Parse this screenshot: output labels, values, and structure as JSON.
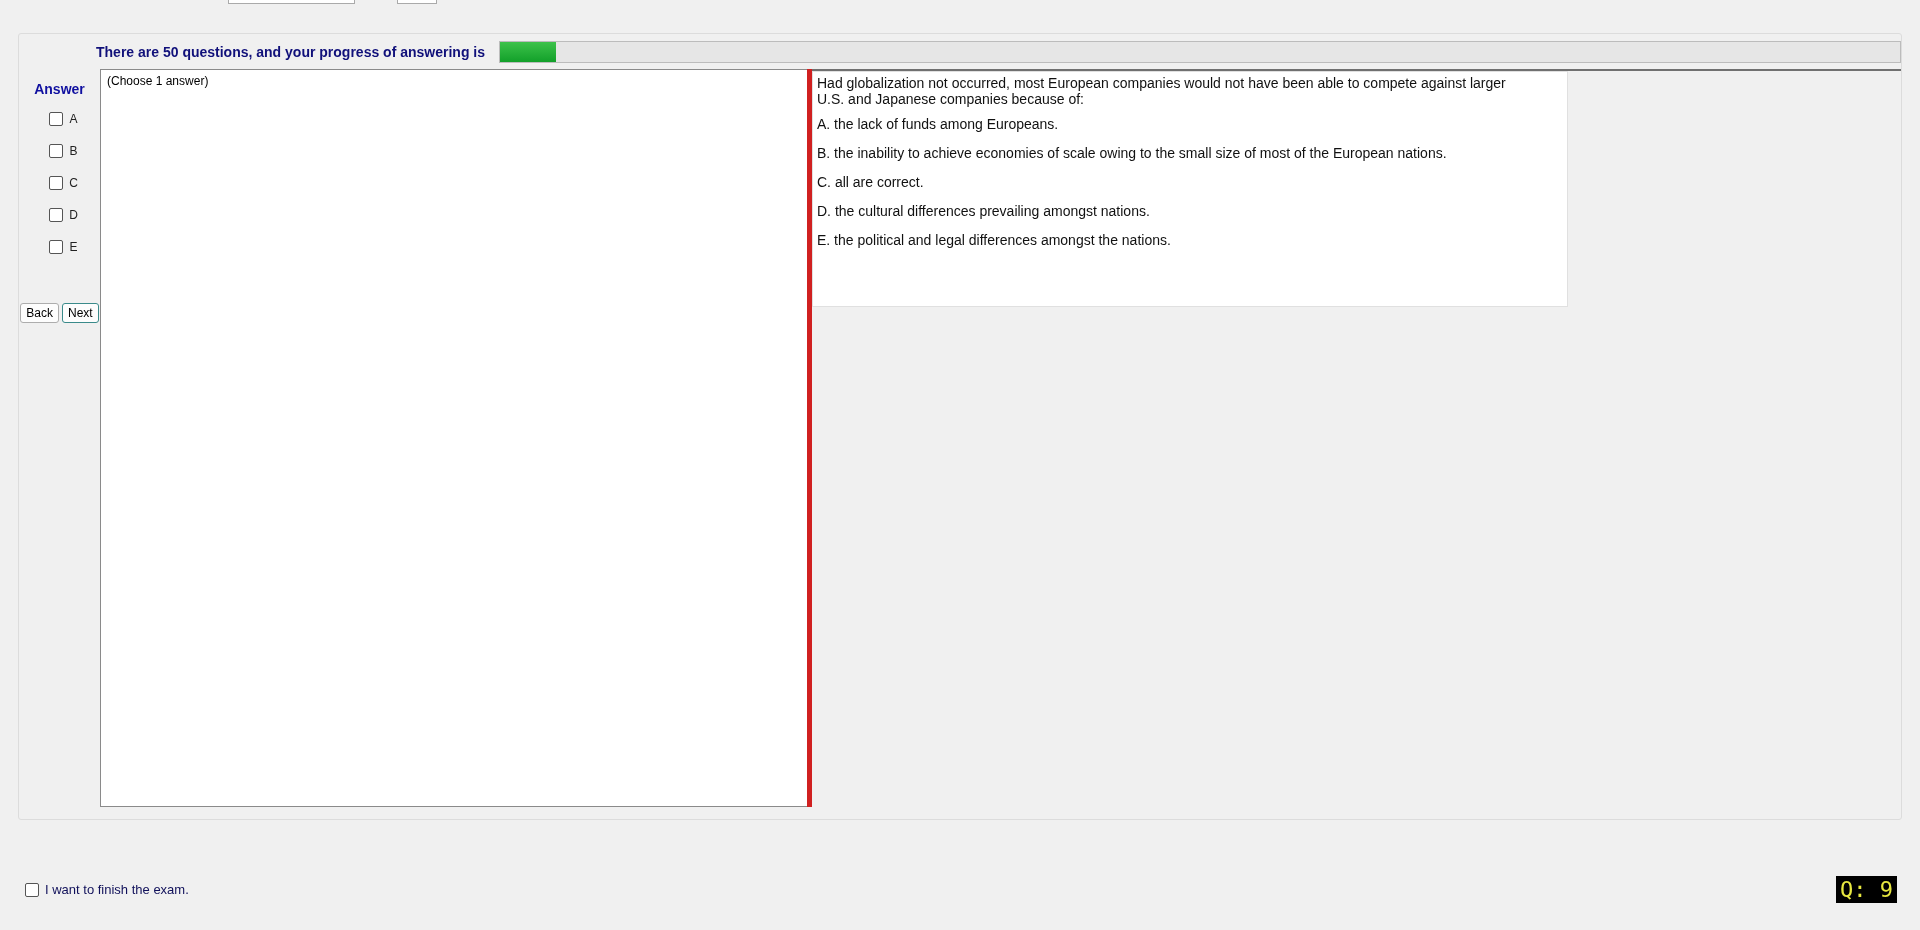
{
  "progress": {
    "label": "There are 50 questions, and your progress of answering is",
    "level": 0.04
  },
  "answer_panel": {
    "title": "Answer",
    "options": [
      {
        "label": "A",
        "checked": false
      },
      {
        "label": "B",
        "checked": false
      },
      {
        "label": "C",
        "checked": false
      },
      {
        "label": "D",
        "checked": false
      },
      {
        "label": "E",
        "checked": false
      }
    ],
    "buttons": [
      "Back",
      "Next"
    ]
  },
  "instruction": "(Choose 1 answer)",
  "question": {
    "text": "Had globalization not occurred, most European companies would not have been able to compete against larger U.S. and Japanese companies because of:",
    "choices": [
      "A.  the lack of funds among Europeans.",
      "B.  the inability to achieve economies of scale owing to the small size of most of the European nations.",
      "C.  all are correct.",
      "D.  the cultural differences prevailing amongst nations.",
      "E.  the political and legal differences amongst the nations."
    ]
  },
  "finish": {
    "label": "I want to finish the exam.",
    "checked": false
  },
  "question_counter": "Q: 9"
}
